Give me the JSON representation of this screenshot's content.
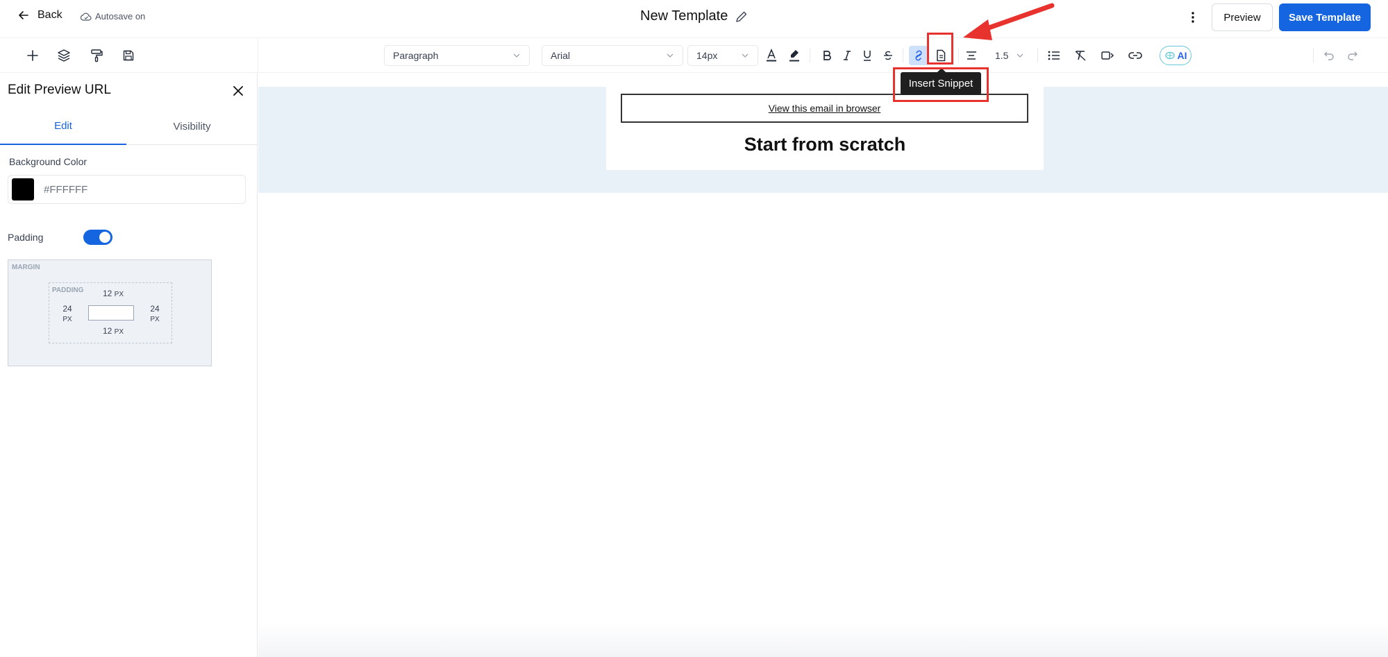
{
  "header": {
    "back_label": "Back",
    "autosave_label": "Autosave on",
    "title": "New Template",
    "preview_label": "Preview",
    "save_label": "Save Template"
  },
  "toolbar": {
    "block_type": "Paragraph",
    "font_family": "Arial",
    "font_size": "14px",
    "line_height": "1.5",
    "ai_label": "AI",
    "tooltip": "Insert Snippet"
  },
  "panel": {
    "title": "Edit Preview URL",
    "tabs": [
      "Edit",
      "Visibility"
    ],
    "active_tab": "Edit",
    "background_color_label": "Background Color",
    "background_color_value": "#FFFFFF",
    "swatch_color": "#000000",
    "padding_label": "Padding",
    "padding_enabled": true,
    "box_model": {
      "margin_label": "MARGIN",
      "padding_label": "PADDING",
      "top": "12",
      "right": "24",
      "bottom": "12",
      "left": "24",
      "unit": "PX"
    }
  },
  "canvas": {
    "link_text": "View this email in browser",
    "heading": "Start from scratch"
  },
  "colors": {
    "accent": "#1565e0",
    "annotation": "#e8322d",
    "canvas_band": "#e8f0f8"
  }
}
